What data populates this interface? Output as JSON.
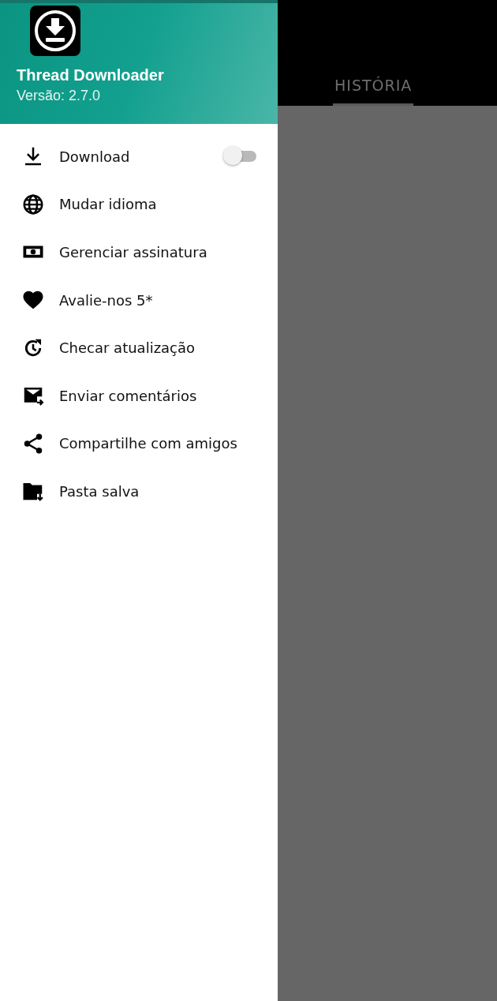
{
  "drawer": {
    "app_name": "Thread Downloader",
    "version": "Versão: 2.7.0",
    "items": [
      {
        "kind": "toggle",
        "label": "Download",
        "on": false
      },
      {
        "kind": "link",
        "label": "Mudar idioma"
      },
      {
        "kind": "link",
        "label": "Gerenciar assinatura"
      },
      {
        "kind": "link",
        "label": "Avalie-nos 5*"
      },
      {
        "kind": "link",
        "label": "Checar atualização"
      },
      {
        "kind": "link",
        "label": "Enviar comentários"
      },
      {
        "kind": "link",
        "label": "Compartilhe com amigos"
      },
      {
        "kind": "link",
        "label": "Pasta salva"
      }
    ]
  },
  "tabs": [
    {
      "label": "HISTÓRIA",
      "selected": true
    }
  ]
}
